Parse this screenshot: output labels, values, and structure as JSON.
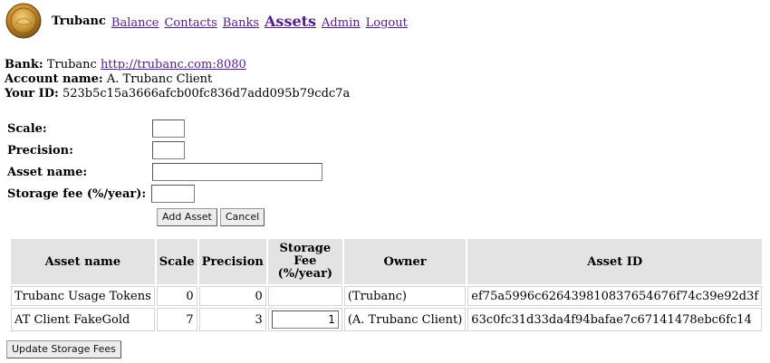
{
  "header": {
    "brand": "Trubanc",
    "nav": [
      "Balance",
      "Contacts",
      "Banks",
      "Assets",
      "Admin",
      "Logout"
    ],
    "active": "Assets"
  },
  "info": {
    "bank_label": "Bank:",
    "bank_name": "Trubanc",
    "bank_url": "http://trubanc.com:8080",
    "account_label": "Account name:",
    "account_name": "A. Trubanc Client",
    "id_label": "Your ID:",
    "id_value": "523b5c15a3666afcb00fc836d7add095b79cdc7a"
  },
  "form": {
    "scale_label": "Scale:",
    "scale_value": "",
    "precision_label": "Precision:",
    "precision_value": "",
    "asset_name_label": "Asset name:",
    "asset_name_value": "",
    "storage_fee_label": "Storage fee (%/year):",
    "storage_fee_value": "",
    "add_button": "Add Asset",
    "cancel_button": "Cancel"
  },
  "table": {
    "headers": [
      "Asset name",
      "Scale",
      "Precision",
      "Storage Fee (%/year)",
      "Owner",
      "Asset ID"
    ],
    "rows": [
      {
        "name": "Trubanc Usage Tokens",
        "scale": "0",
        "precision": "0",
        "fee": "",
        "owner": "(Trubanc)",
        "asset_id": "ef75a5996c62643981083765467 6f74c39e92d3f"
      },
      {
        "name": "AT Client FakeGold",
        "scale": "7",
        "precision": "3",
        "fee": "1",
        "owner": "(A. Trubanc Client)",
        "asset_id": "63c0fc31d33da4f94bafae7c67141478ebc6fc14"
      }
    ]
  },
  "update_button": "Update Storage Fees"
}
